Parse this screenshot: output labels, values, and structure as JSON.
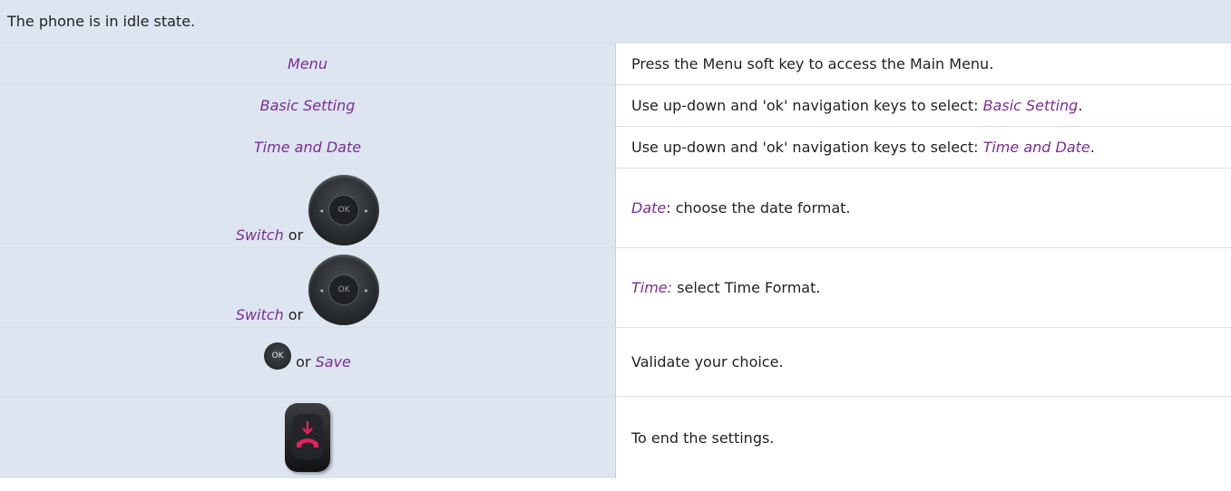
{
  "header": {
    "text": "The phone is in idle state."
  },
  "rows": [
    {
      "action": "Menu",
      "description": "Press the Menu soft key to access the Main Menu."
    },
    {
      "action": "Basic Setting",
      "description_prefix": "Use up-down and 'ok' navigation keys to select: ",
      "description_em": "Basic Setting",
      "description_suffix": "."
    },
    {
      "action": "Time and Date",
      "description_prefix": "Use up-down and 'ok' navigation keys to select: ",
      "description_em": "Time and Date",
      "description_suffix": "."
    },
    {
      "action_em": "Switch",
      "action_or": " or",
      "description_em": "Date",
      "description_rest": ": choose the date format."
    },
    {
      "action_em": "Switch",
      "action_or": " or",
      "description_em": "Time:",
      "description_rest": " select Time Format."
    },
    {
      "ok_label": "OK",
      "action_or": " or ",
      "action_em": "Save",
      "description": "Validate your choice."
    },
    {
      "description": "To end the settings."
    }
  ],
  "icons": {
    "nav_key": "navigation-key-icon",
    "ok_key": "ok-key-icon",
    "end_call": "end-call-key-icon",
    "nav_ok_label": "OK"
  },
  "colors": {
    "header_bg": "#dce5f0",
    "accent_text": "#7b2d96",
    "end_call_red": "#e0245e"
  }
}
